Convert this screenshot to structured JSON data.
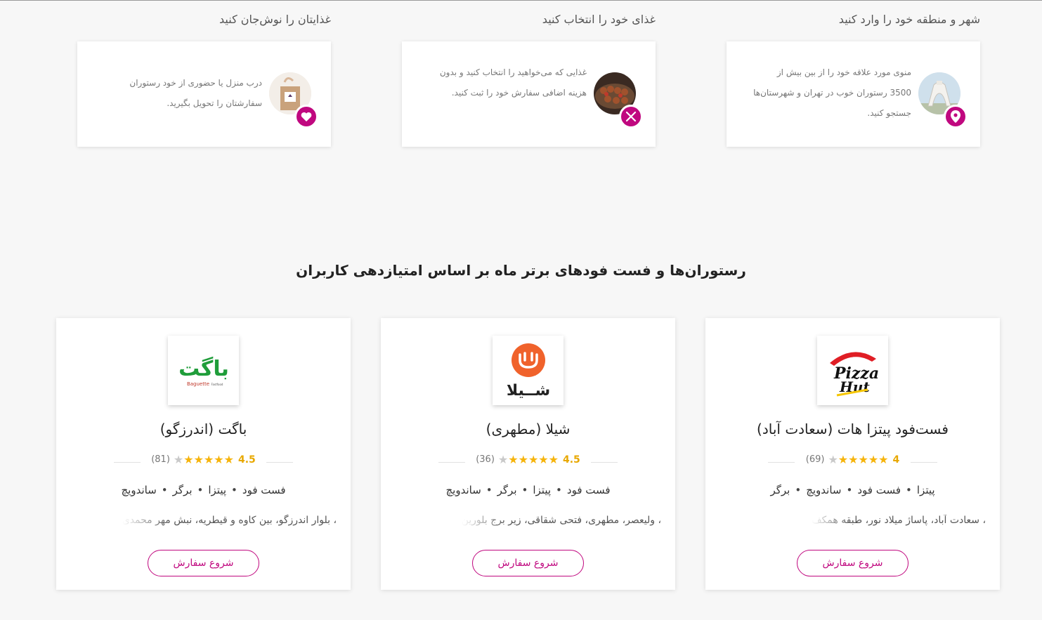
{
  "steps": [
    {
      "title": "شهر و منطقه خود را وارد کنید",
      "text": "منوی مورد علاقه خود را از بین بیش از 3500 رستوران خوب در تهران و شهرستان‌ها جستجو کنید.",
      "badge_icon": "location-pin-icon",
      "image": "azadi-tower"
    },
    {
      "title": "غذای خود را انتخاب کنید",
      "text": "غذایی که می‌خواهید را انتخاب کنید و بدون هزینه اضافی سفارش خود را ثبت کنید.",
      "badge_icon": "fork-knife-icon",
      "image": "kebab"
    },
    {
      "title": "غذایتان را نوش‌جان کنید",
      "text": "درب منزل یا حضوری از خود رستوران سفارشتان را تحویل بگیرید.",
      "badge_icon": "heart-icon",
      "image": "shopping-bag"
    }
  ],
  "section": {
    "title": "رستوران‌ها و فست فودهای برتر ماه بر اساس امتیازدهی کاربران"
  },
  "restaurants": [
    {
      "name": "فست‌فود پیتزا هات (سعادت آباد)",
      "rating": "4",
      "stars_filled": 5,
      "stars_total": 6,
      "count": "(69)",
      "tags": [
        "پیتزا",
        "فست فود",
        "ساندویچ",
        "برگر"
      ],
      "address": "، سعادت آباد، پاساژ میلاد نور، طبقه همکف",
      "button": "شروع سفارش",
      "logo": "pizza-hut-logo",
      "logo_text": [
        "Pizza",
        "Hut"
      ]
    },
    {
      "name": "شیلا (مطهری)",
      "rating": "4.5",
      "stars_filled": 5,
      "stars_total": 6,
      "count": "(36)",
      "tags": [
        "فست فود",
        "پیتزا",
        "برگر",
        "ساندویچ"
      ],
      "address": "، ولیعصر، مطهری، فتحی شقاقی، زیر برج بلورین",
      "button": "شروع سفارش",
      "logo": "shila-logo",
      "logo_text": [
        "شــیلا"
      ]
    },
    {
      "name": "باگت (اندرزگو)",
      "rating": "4.5",
      "stars_filled": 5,
      "stars_total": 6,
      "count": "(81)",
      "tags": [
        "فست فود",
        "پیتزا",
        "برگر",
        "ساندویچ"
      ],
      "address": "، بلوار اندرزگو، بین کاوه و قیطریه، نبش مهر محمدی",
      "button": "شروع سفارش",
      "logo": "baguette-logo",
      "logo_text": [
        "باگت",
        "Baguette",
        "Fastfood"
      ]
    }
  ],
  "colors": {
    "accent": "#c0087f",
    "star": "#f6b40c",
    "rating_text": "#e8a800",
    "background": "#f7f7f7",
    "card": "#ffffff"
  }
}
